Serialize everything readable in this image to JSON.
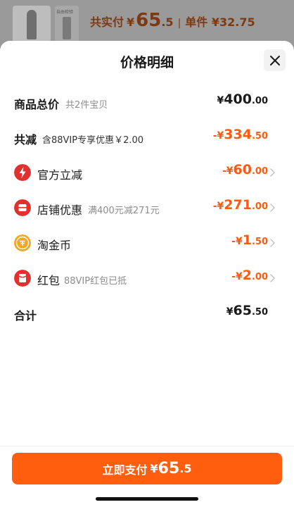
{
  "background": {
    "thumb2_tag": "自由检验",
    "total_label": "共实付",
    "total_yen": "¥",
    "total_int": "65",
    "total_dec": ".5",
    "separator": "|",
    "unit_price": "单件 ¥32.75"
  },
  "sheet": {
    "title": "价格明细",
    "close_icon": "close-icon"
  },
  "rows": {
    "goods_total": {
      "label": "商品总价",
      "sub": "共2件宝贝",
      "yen": "¥",
      "int": "400",
      "dec": ".00"
    },
    "total_discount": {
      "label": "共减",
      "sub": "含88VIP专享优惠￥2.00",
      "yen": "-¥",
      "int": "334",
      "dec": ".50"
    },
    "official": {
      "label": "官方立减",
      "sub": "",
      "yen": "-¥",
      "int": "60",
      "dec": ".00",
      "icon": "lightning-icon"
    },
    "store": {
      "label": "店铺优惠",
      "sub": "满400元减271元",
      "yen": "-¥",
      "int": "271",
      "dec": ".00",
      "icon": "store-coupon-icon"
    },
    "coins": {
      "label": "淘金币",
      "sub": "",
      "yen": "-¥",
      "int": "1",
      "dec": ".50",
      "icon": "gold-coin-icon"
    },
    "redpacket": {
      "label": "红包",
      "sub": "88VIP红包已抵",
      "yen": "-¥",
      "int": "2",
      "dec": ".00",
      "icon": "red-packet-icon"
    },
    "sum": {
      "label": "合计",
      "yen": "¥",
      "int": "65",
      "dec": ".50"
    }
  },
  "pay_button": {
    "label": "立即支付",
    "yen": "¥",
    "int": "65",
    "dec": ".5"
  },
  "colors": {
    "accent": "#ff5e0f",
    "discount": "#ff5a10",
    "red_icon": "#e0312e",
    "gold_icon": "#f2a623"
  }
}
